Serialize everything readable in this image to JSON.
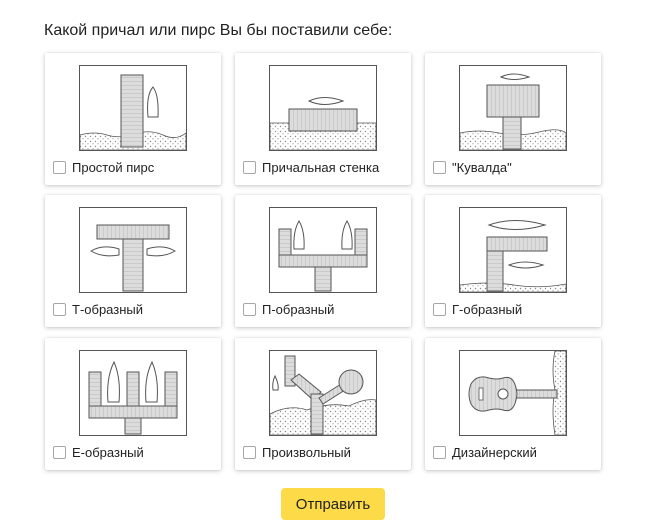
{
  "question": "Какой причал или пирс Вы бы поставили себе:",
  "options": [
    {
      "label": "Простой пирс",
      "checked": false,
      "icon": "simple-pier-icon"
    },
    {
      "label": "Причальная стенка",
      "checked": false,
      "icon": "quay-wall-icon"
    },
    {
      "label": "\"Кувалда\"",
      "checked": false,
      "icon": "sledgehammer-pier-icon"
    },
    {
      "label": "Т-образный",
      "checked": false,
      "icon": "t-shaped-pier-icon"
    },
    {
      "label": "П-образный",
      "checked": false,
      "icon": "u-shaped-pier-icon"
    },
    {
      "label": "Г-образный",
      "checked": false,
      "icon": "l-shaped-pier-icon"
    },
    {
      "label": "Е-образный",
      "checked": false,
      "icon": "e-shaped-pier-icon"
    },
    {
      "label": "Произвольный",
      "checked": false,
      "icon": "freeform-pier-icon"
    },
    {
      "label": "Дизайнерский",
      "checked": false,
      "icon": "designer-pier-icon"
    }
  ],
  "submit_label": "Отправить",
  "colors": {
    "accent": "#fddb48",
    "deck": "#d9d9d9",
    "outline": "#555555"
  }
}
